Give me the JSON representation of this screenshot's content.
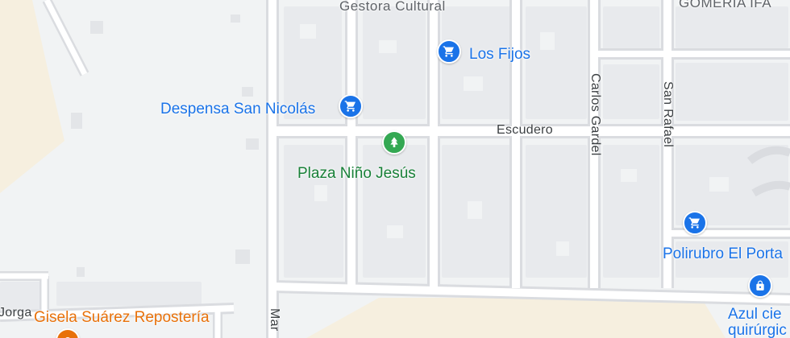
{
  "map": {
    "streets": {
      "escudero": "Escudero",
      "carlos_gardel": "Carlos Gardel",
      "san_rafael": "San Rafael",
      "mar_partial": "Mar",
      "jorge_partial": "Jorga"
    },
    "places": {
      "gestora_cultural": "Gestora Cultural",
      "los_fijos": "Los Fijos",
      "despensa": "Despensa San Nicolás",
      "plaza": "Plaza Niño Jesús",
      "polirubro": "Polirubro El Porta",
      "gomeria": "GOMERIA IFA",
      "gisela": "Gisela Suárez Repostería",
      "azul_line1": "Azul cie",
      "azul_line2": "quirúrgic"
    },
    "icons": {
      "shopping_cart": "shopping-cart-icon",
      "tree": "tree-icon",
      "lock": "lock-icon"
    },
    "colors": {
      "background": "#f1f3f4",
      "road": "#dadce0",
      "road_fill": "#ffffff",
      "block": "#e8eaed",
      "sand": "#f8f1e3",
      "poi_blue": "#1a73e8",
      "poi_green": "#188038",
      "poi_orange": "#e8710a"
    }
  }
}
